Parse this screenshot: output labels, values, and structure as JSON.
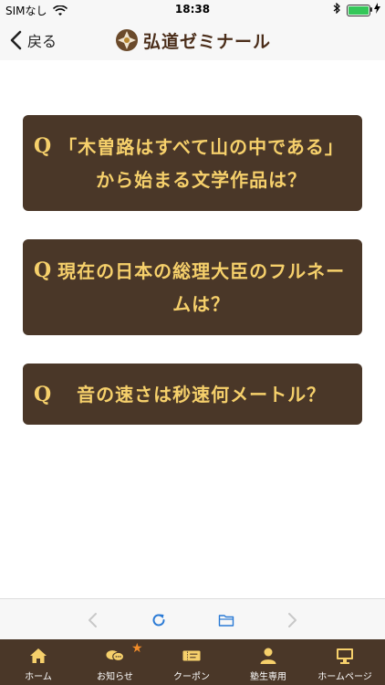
{
  "status_bar": {
    "carrier": "SIMなし",
    "time": "18:38"
  },
  "navbar": {
    "back_label": "戻る",
    "logo_text": "弘道ゼミナール"
  },
  "questions": [
    {
      "marker": "Q",
      "text": "「木曽路はすべて山の中である」から始まる文学作品は？"
    },
    {
      "marker": "Q",
      "text": "現在の日本の総理大臣のフルネームは？"
    },
    {
      "marker": "Q",
      "text": "音の速さは秒速何メートル？"
    }
  ],
  "browser_toolbar": {
    "icons": [
      "chevron-left-icon",
      "reload-icon",
      "folder-icon",
      "chevron-right-icon"
    ]
  },
  "tabs": [
    {
      "label": "ホーム",
      "icon": "home-icon"
    },
    {
      "label": "お知らせ",
      "icon": "chat-bubbles-icon",
      "badge": "star"
    },
    {
      "label": "クーポン",
      "icon": "ticket-icon"
    },
    {
      "label": "塾生専用",
      "icon": "person-icon"
    },
    {
      "label": "ホームページ",
      "icon": "monitor-icon"
    }
  ],
  "colors": {
    "card_bg": "#4a3728",
    "card_text": "#f6d06b",
    "tabbar_bg": "#4a3728",
    "accent_blue": "#2a7ad5",
    "badge_orange": "#f28c28"
  }
}
